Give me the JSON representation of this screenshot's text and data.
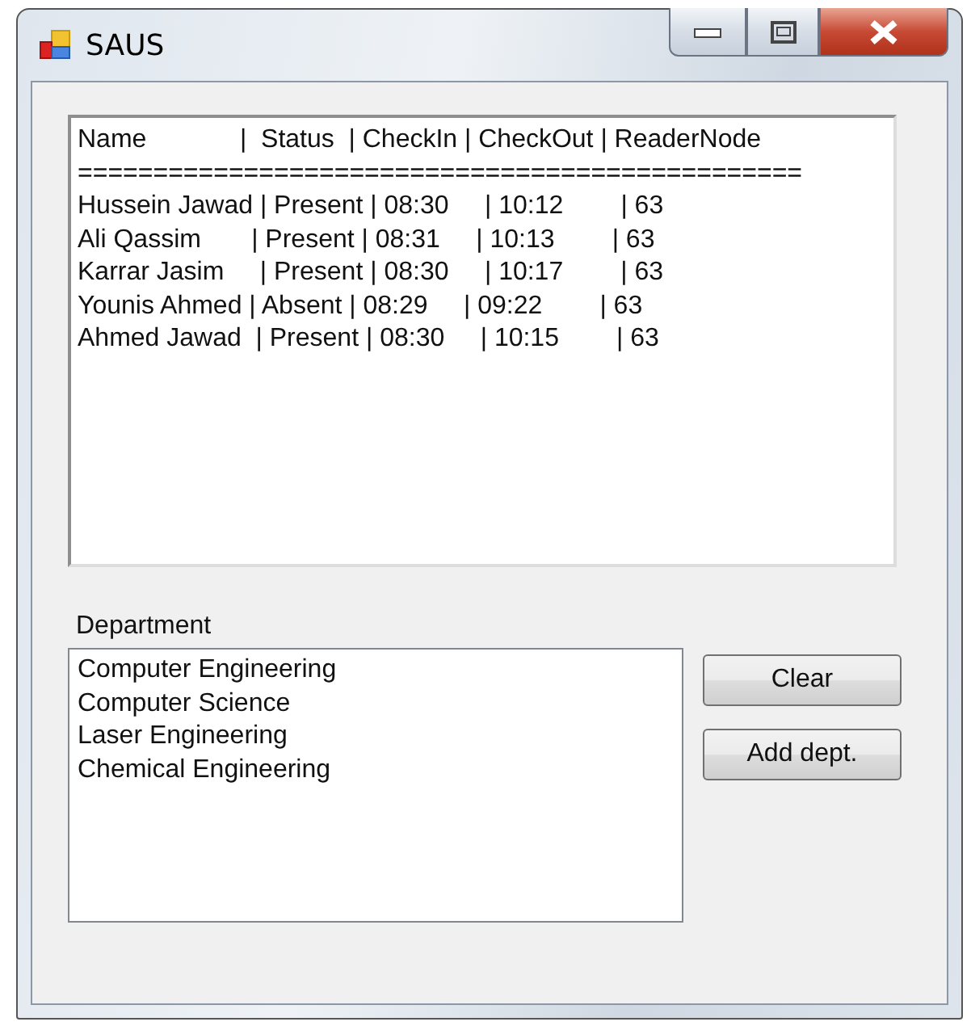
{
  "window": {
    "title": "SAUS"
  },
  "report": {
    "lines": [
      "Name             |  Status  | CheckIn | CheckOut | ReaderNode",
      "================================================",
      "Hussein Jawad | Present | 08:30     | 10:12        | 63",
      "Ali Qassim       | Present | 08:31     | 10:13        | 63",
      "Karrar Jasim     | Present | 08:30     | 10:17        | 63",
      "Younis Ahmed | Absent | 08:29     | 09:22        | 63",
      "Ahmed Jawad  | Present | 08:30     | 10:15        | 63"
    ]
  },
  "department": {
    "label": "Department",
    "items": [
      "Computer Engineering",
      "Computer Science",
      "Laser Engineering",
      "Chemical Engineering"
    ]
  },
  "buttons": [
    "Clear",
    "Add dept."
  ]
}
